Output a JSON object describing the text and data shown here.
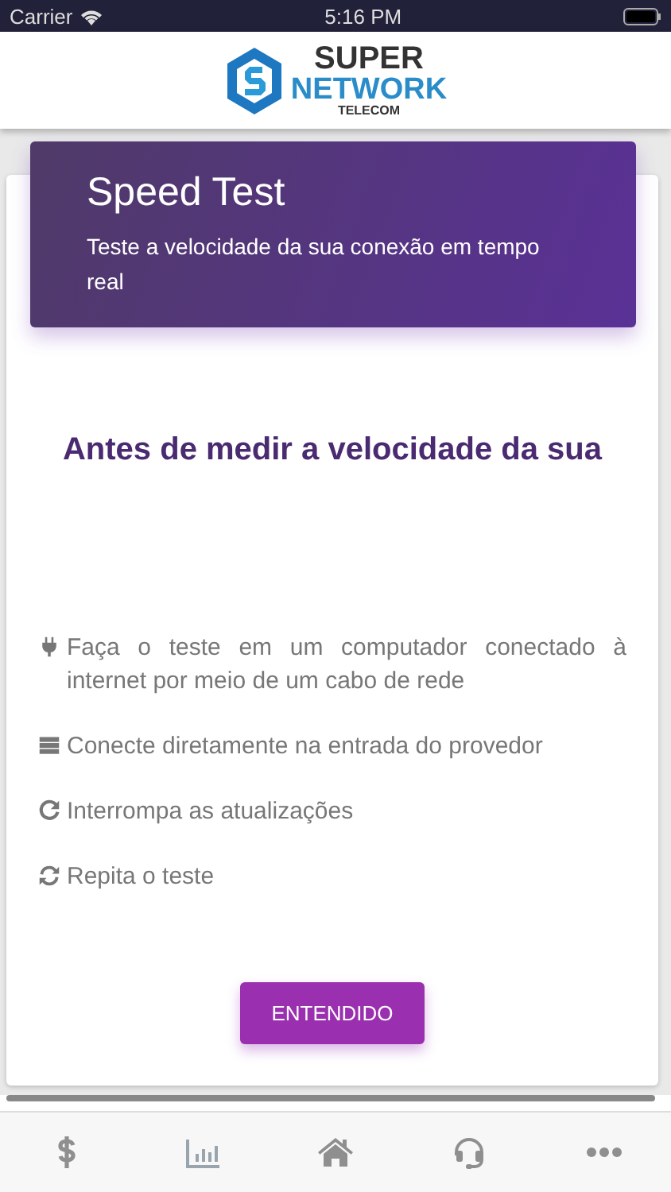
{
  "status_bar": {
    "carrier": "Carrier",
    "time": "5:16 PM"
  },
  "header": {
    "logo": {
      "line1": "SUPER",
      "line2": "NETWORK",
      "line3": "TELECOM"
    }
  },
  "banner": {
    "title": "Speed Test",
    "subtitle": "Teste a velocidade da sua conexão em tempo real"
  },
  "heading": "Antes de medir a velocidade da sua",
  "tips": [
    {
      "kind": "plug",
      "text": "Faça o teste em um computador conectado à internet por meio de um cabo de rede"
    },
    {
      "kind": "server",
      "text": "Conecte diretamente na entrada do provedor"
    },
    {
      "kind": "redo",
      "text": "Interrompa as atualizações"
    },
    {
      "kind": "refresh",
      "text": "Repita o teste"
    }
  ],
  "button": "ENTENDIDO",
  "tab_bar": [
    {
      "kind": "dollar"
    },
    {
      "kind": "chart"
    },
    {
      "kind": "home"
    },
    {
      "kind": "headset"
    },
    {
      "kind": "more"
    }
  ]
}
